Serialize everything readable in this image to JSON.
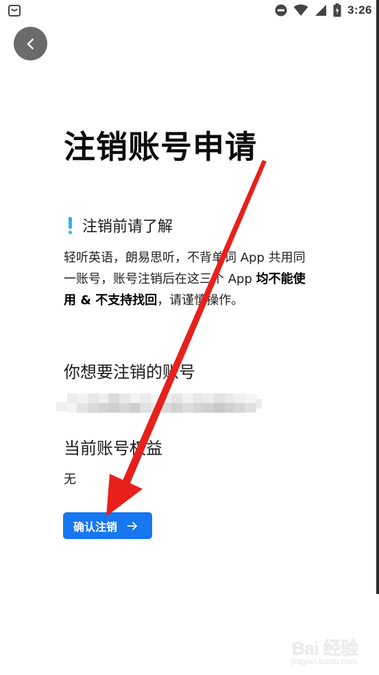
{
  "status_bar": {
    "time": "3:26",
    "icons": [
      "shopping-bag-icon",
      "do-not-disturb-icon",
      "wifi-icon",
      "signal-icon",
      "battery-icon"
    ]
  },
  "header": {
    "back_icon": "chevron-left-icon"
  },
  "main": {
    "title": "注销账号申请",
    "notice": {
      "icon": "exclamation-icon",
      "icon_color": "#2ab6e3",
      "title": "注销前请了解",
      "body_part1": "轻听英语，朗易思听，不背单词 App 共用同一账号，账号注销后在这三个 App ",
      "body_bold": "均不能使用 & 不支持找回",
      "body_part2": "，请谨慎操作。"
    },
    "account_section": {
      "title": "你想要注销的账号",
      "value_obscured": true
    },
    "rights_section": {
      "title": "当前账号权益",
      "value": "无"
    },
    "confirm_button": {
      "label": "确认注销",
      "icon": "arrow-right-icon",
      "color": "#1677f0"
    }
  },
  "annotation": {
    "arrow_color": "#e8201b"
  },
  "watermark": {
    "main": "Bai 经验",
    "sub": "jingyan.baidu.com"
  }
}
